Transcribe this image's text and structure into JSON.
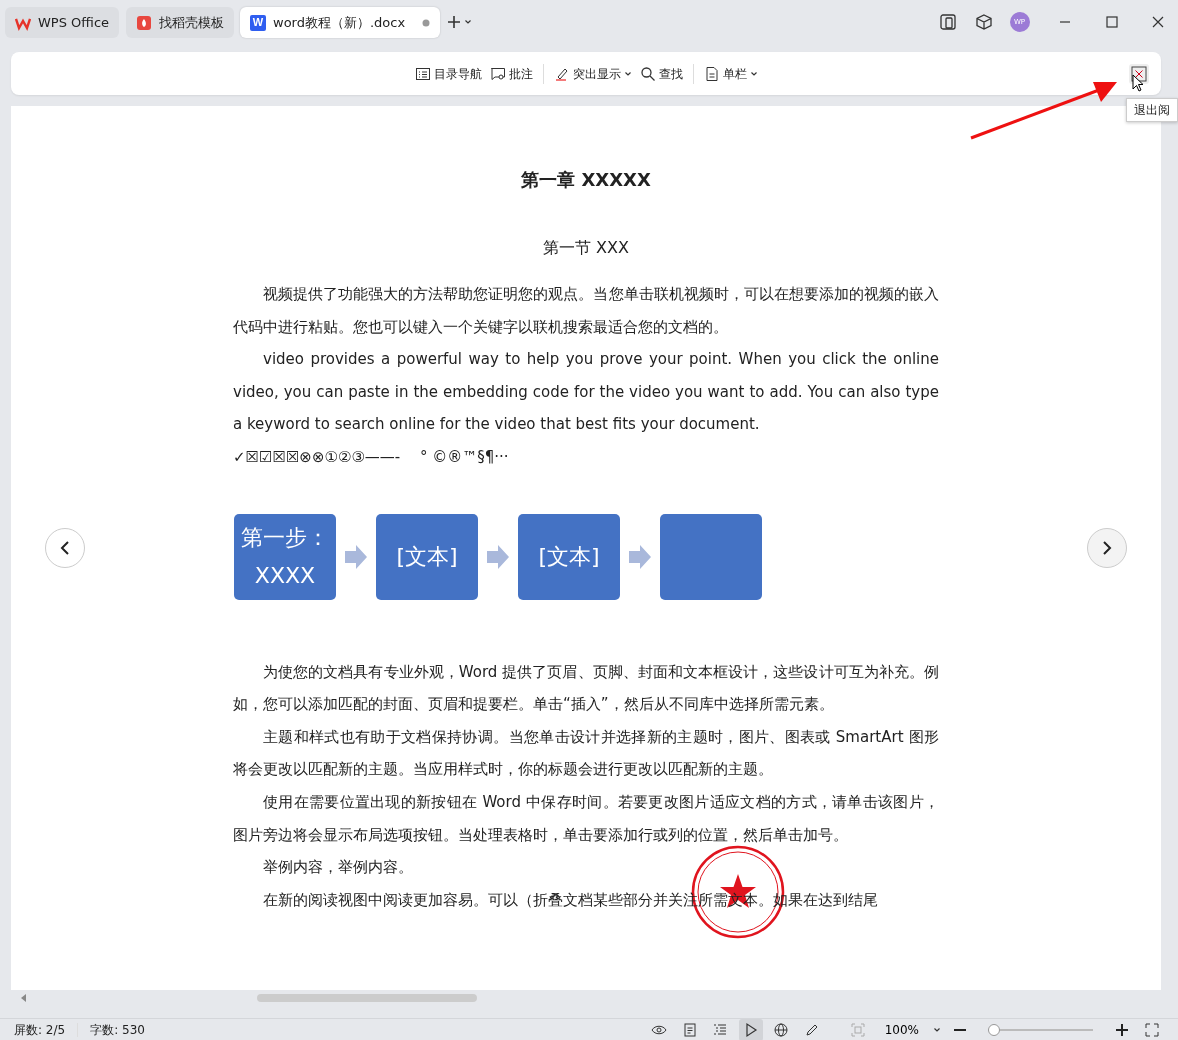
{
  "tabs": [
    {
      "label": "WPS Office",
      "kind": "home",
      "selected": false
    },
    {
      "label": "找稻壳模板",
      "kind": "template",
      "selected": false
    },
    {
      "label": "word教程（新）.docx",
      "kind": "doc",
      "badge": "W",
      "selected": true
    }
  ],
  "account": {
    "initials": "WP"
  },
  "toolbar": [
    {
      "label": "目录导航",
      "dropdown": false
    },
    {
      "label": "批注",
      "dropdown": false
    },
    {
      "label": "突出显示",
      "dropdown": true
    },
    {
      "label": "查找",
      "dropdown": false
    },
    {
      "label": "单栏",
      "dropdown": true
    }
  ],
  "exit_tooltip": "退出阅",
  "document": {
    "title": "第一章  XXXXX",
    "section": "第一节  XXX",
    "paragraphs": [
      {
        "text": "视频提供了功能强大的方法帮助您证明您的观点。当您单击联机视频时，可以在想要添加的视频的嵌入代码中进行粘贴。您也可以键入一个关键字以联机搜索最适合您的文档的。",
        "indent": true
      },
      {
        "text": "video provides a powerful way to help you prove your point. When you click the online video, you can paste in the embedding code for the video you want to add. You can also type a keyword to search online for the video that best fits your document.",
        "indent": true
      },
      {
        "text": "✓☒☑☒☒⊗⊗①②③——-　 °  ©®™§¶···",
        "indent": false
      }
    ],
    "flow": [
      {
        "kind": "text",
        "text": "第一步：XXXX"
      },
      {
        "kind": "text",
        "text": "[文本]"
      },
      {
        "kind": "text",
        "text": "[文本]"
      },
      {
        "kind": "blank"
      }
    ],
    "paragraphs_after": [
      {
        "text": "为使您的文档具有专业外观，Word 提供了页眉、页脚、封面和文本框设计，这些设计可互为补充。例如，您可以添加匹配的封面、页眉和提要栏。单击“插入”，然后从不同库中选择所需元素。",
        "indent": true
      },
      {
        "text": "主题和样式也有助于文档保持协调。当您单击设计并选择新的主题时，图片、图表或 SmartArt 图形将会更改以匹配新的主题。当应用样式时，你的标题会进行更改以匹配新的主题。",
        "indent": true
      },
      {
        "text": "使用在需要位置出现的新按钮在 Word 中保存时间。若要更改图片适应文档的方式，请单击该图片，图片旁边将会显示布局选项按钮。当处理表格时，单击要添加行或列的位置，然后单击加号。",
        "indent": true
      },
      {
        "text": "举例内容，举例内容。",
        "indent": true
      },
      {
        "text": "在新的阅读视图中阅读更加容易。可以（折叠文档某些部分并关注所需文本。如果在达到结尾",
        "indent": true
      }
    ]
  },
  "status_bar": {
    "pages": "屏数: 2/5",
    "words": "字数: 530",
    "view_buttons": [
      {
        "selected": false
      },
      {
        "selected": false
      },
      {
        "selected": false
      },
      {
        "selected": true
      },
      {
        "selected": false
      },
      {
        "selected": false
      }
    ],
    "zoom": {
      "label": "100%",
      "level": 0.0
    }
  }
}
